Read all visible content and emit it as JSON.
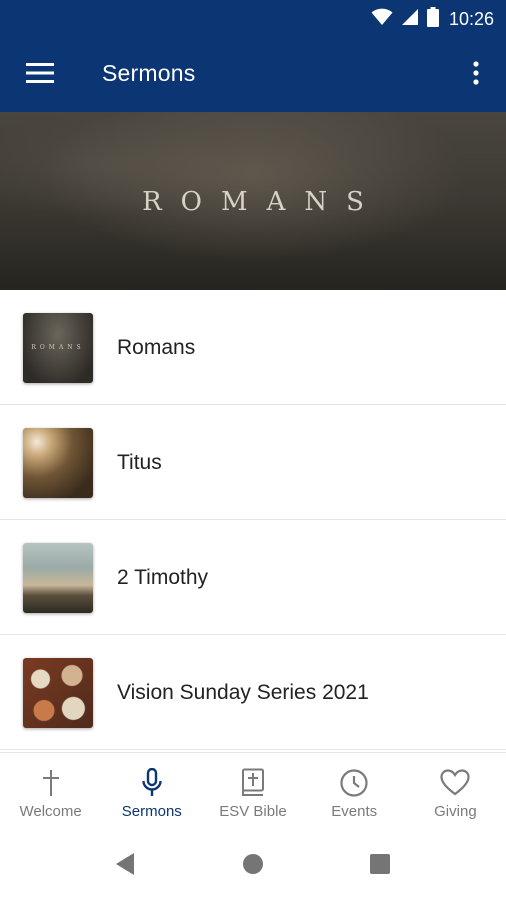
{
  "status_bar": {
    "time": "10:26",
    "icons": [
      "wifi-icon",
      "cellular-signal-icon",
      "battery-icon"
    ]
  },
  "app_bar": {
    "title": "Sermons",
    "menu_icon": "hamburger-menu-icon",
    "more_icon": "more-vertical-icon"
  },
  "hero": {
    "text": "ROMANS"
  },
  "sermon_series": [
    {
      "title": "Romans",
      "thumb_text": "ROMANS"
    },
    {
      "title": "Titus"
    },
    {
      "title": "2 Timothy"
    },
    {
      "title": "Vision Sunday Series 2021"
    }
  ],
  "bottom_nav": [
    {
      "label": "Welcome",
      "icon": "cross-icon",
      "active": false
    },
    {
      "label": "Sermons",
      "icon": "microphone-icon",
      "active": true
    },
    {
      "label": "ESV Bible",
      "icon": "bible-icon",
      "active": false
    },
    {
      "label": "Events",
      "icon": "clock-icon",
      "active": false
    },
    {
      "label": "Giving",
      "icon": "heart-icon",
      "active": false
    }
  ],
  "system_nav": [
    "back-icon",
    "home-icon",
    "recents-icon"
  ],
  "colors": {
    "primary": "#0b3573",
    "inactive": "#7a7a7a",
    "divider": "#e4e4e4"
  }
}
